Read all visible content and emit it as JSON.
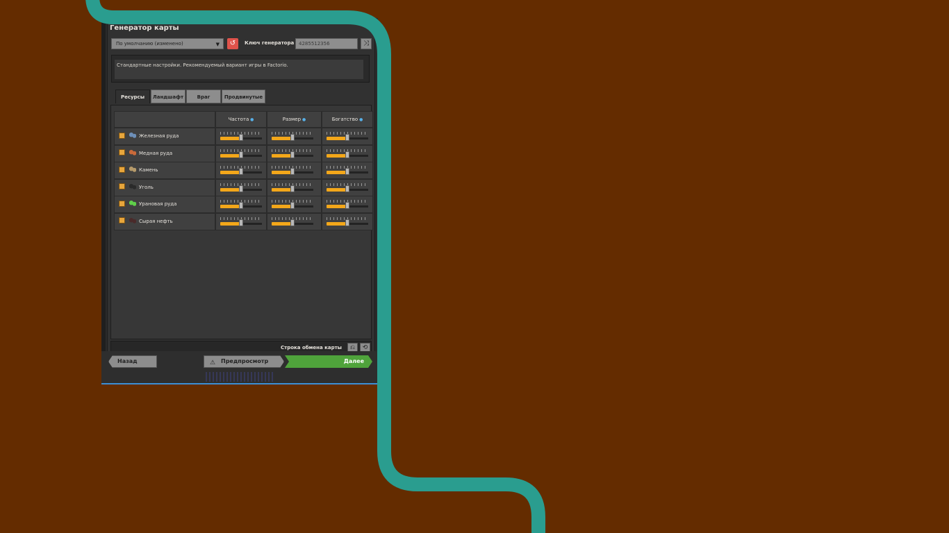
{
  "window": {
    "title": "Генератор карты"
  },
  "preset": {
    "selected": "По умолчанию (изменено)"
  },
  "seed": {
    "label": "Ключ генератора",
    "value": "4285512356"
  },
  "description": "Стандартные настройки. Рекомендуемый вариант игры в Factorio.",
  "tabs": [
    {
      "label": "Ресурсы",
      "active": true
    },
    {
      "label": "Ландшафт",
      "active": false
    },
    {
      "label": "Враг",
      "active": false
    },
    {
      "label": "Продвинутые",
      "active": false
    }
  ],
  "table": {
    "columns": [
      "Частота",
      "Размер",
      "Богатство"
    ],
    "rows": [
      {
        "name": "Железная руда",
        "enabled": true,
        "icon": "iron-ore-icon",
        "values": [
          0.5,
          0.5,
          0.5
        ]
      },
      {
        "name": "Медная руда",
        "enabled": true,
        "icon": "copper-ore-icon",
        "values": [
          0.5,
          0.5,
          0.5
        ]
      },
      {
        "name": "Камень",
        "enabled": true,
        "icon": "stone-icon",
        "values": [
          0.5,
          0.5,
          0.5
        ]
      },
      {
        "name": "Уголь",
        "enabled": true,
        "icon": "coal-icon",
        "values": [
          0.5,
          0.5,
          0.5
        ]
      },
      {
        "name": "Урановая руда",
        "enabled": true,
        "icon": "uranium-ore-icon",
        "values": [
          0.5,
          0.5,
          0.5
        ]
      },
      {
        "name": "Сырая нефть",
        "enabled": true,
        "icon": "crude-oil-icon",
        "values": [
          0.5,
          0.5,
          0.5
        ]
      }
    ]
  },
  "exchange": {
    "label": "Строка обмена карты"
  },
  "nav": {
    "back": "Назад",
    "preview": "Предпросмотр",
    "next": "Далее"
  },
  "colors": {
    "background": "#642c00",
    "accent_line": "#2a9d8f",
    "slider_fill": "#f3a71a",
    "next_button": "#4fa33b",
    "reset_button": "#e0534b"
  }
}
